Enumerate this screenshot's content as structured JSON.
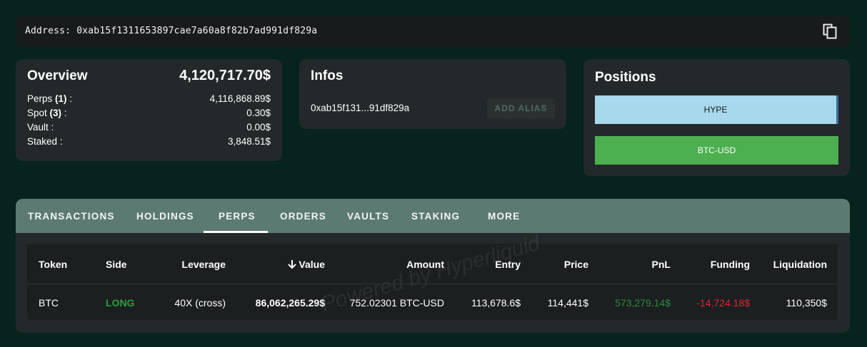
{
  "address_bar": {
    "label": "Address:",
    "address": "0xab15f1311653897cae7a60a8f82b7ad991df829a",
    "copy_icon": "copy-icon"
  },
  "overview": {
    "title": "Overview",
    "total": "4,120,717.70$",
    "rows": [
      {
        "label": "Perps",
        "count": "(1)",
        "suffix": " :",
        "value": "4,116,868.89$"
      },
      {
        "label": "Spot",
        "count": "(3)",
        "suffix": " :",
        "value": "0.30$"
      },
      {
        "label": "Vault :",
        "value": "0.00$"
      },
      {
        "label": "Staked :",
        "value": "3,848.51$"
      }
    ]
  },
  "infos": {
    "title": "Infos",
    "short_address": "0xab15f131...91df829a",
    "add_alias_label": "ADD ALIAS"
  },
  "positions": {
    "title": "Positions",
    "items": [
      {
        "label": "HYPE",
        "color": "#a8d8ec"
      },
      {
        "label": "BTC-USD",
        "color": "#4caf50"
      }
    ]
  },
  "tabs": [
    "TRANSACTIONS",
    "HOLDINGS",
    "PERPS",
    "ORDERS",
    "VAULTS",
    "STAKING",
    "MORE"
  ],
  "active_tab": "PERPS",
  "table": {
    "columns": [
      "Token",
      "Side",
      "Leverage",
      "Value",
      "Amount",
      "Entry",
      "Price",
      "PnL",
      "Funding",
      "Liquidation"
    ],
    "sort_icon": "arrow-down-icon",
    "rows": [
      {
        "token": "BTC",
        "side": "LONG",
        "leverage": "40X (cross)",
        "value": "86,062,265.29$",
        "amount": "752.02301 BTC-USD",
        "entry": "113,678.6$",
        "price": "114,441$",
        "pnl": "573,279.14$",
        "funding": "-14,724.18$",
        "liquidation": "110,350$"
      }
    ]
  },
  "watermark": "Powered by Hyperliquid",
  "colors": {
    "long": "#2e9e3e",
    "pnl_positive": "#2e8b3a",
    "funding_negative": "#e0252f"
  }
}
